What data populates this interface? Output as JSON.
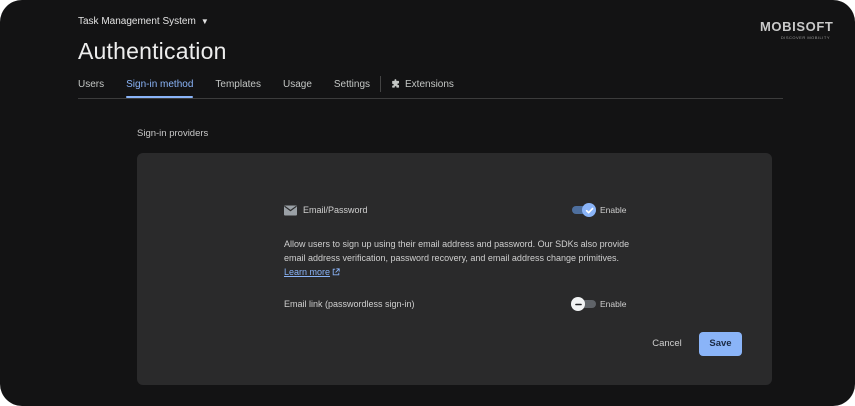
{
  "header": {
    "project_name": "Task Management System",
    "page_title": "Authentication"
  },
  "logo": {
    "wordmark": "MOBISOFT",
    "tagline": "DISCOVER MOBILITY"
  },
  "tabs": [
    {
      "label": "Users",
      "active": false
    },
    {
      "label": "Sign-in method",
      "active": true
    },
    {
      "label": "Templates",
      "active": false
    },
    {
      "label": "Usage",
      "active": false
    },
    {
      "label": "Settings",
      "active": false
    },
    {
      "label": "Extensions",
      "active": false,
      "icon": "puzzle-piece-icon"
    }
  ],
  "main": {
    "section_label": "Sign-in providers"
  },
  "providers": {
    "email_password": {
      "icon": "mail-icon",
      "name": "Email/Password",
      "toggle_label": "Enable",
      "enabled": true,
      "description": "Allow users to sign up using their email address and password. Our SDKs also provide email address verification, password recovery, and email address change primitives.",
      "learn_more": "Learn more"
    },
    "email_link": {
      "name": "Email link (passwordless sign-in)",
      "toggle_label": "Enable",
      "enabled": false
    }
  },
  "actions": {
    "cancel_label": "Cancel",
    "save_label": "Save"
  },
  "colors": {
    "background": "#131314",
    "card": "#2a2a2b",
    "accent": "#8ab4f8",
    "text": "#e3e3e3"
  }
}
